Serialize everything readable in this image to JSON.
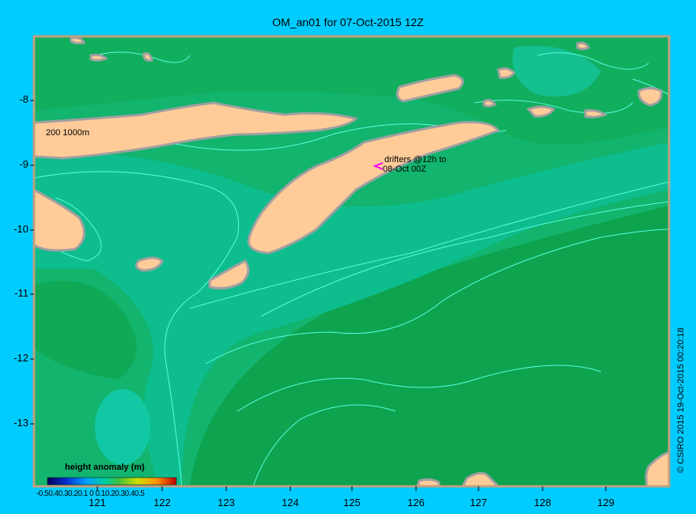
{
  "title": "OM_an01 for 07-Oct-2015 12Z",
  "y_axis_labels": [
    "-8",
    "-9",
    "-10",
    "-11",
    "-12",
    "-13"
  ],
  "x_axis_labels": [
    "121",
    "122",
    "123",
    "124",
    "125",
    "126",
    "127",
    "128",
    "129"
  ],
  "depth_contour_label": "200  1000m",
  "drifters_line1": "drifters @12h to",
  "drifters_line2": "08-Oct 00Z",
  "legend_title": "height anomaly (m)",
  "colorbar_labels": "-0.50.40.30.20.1 0 0.10.20.30.40.5",
  "credit": "© CSIRO 2015   19-Oct-2015 00:20:18",
  "colors": {
    "background": "#00ccff",
    "ocean_base": "#12b46e",
    "land": "#ffcc99",
    "contour": "#55ffdd",
    "drifter": "#ff00ff"
  }
}
